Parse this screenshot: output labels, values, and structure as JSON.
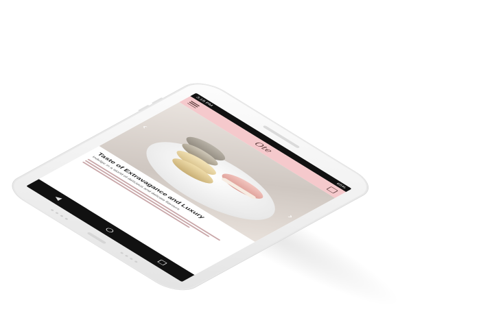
{
  "status_bar": {
    "left": "3:18 PM",
    "right": "65%"
  },
  "app_header": {
    "logo": "Ote"
  },
  "hero": {
    "prev_arrow": "‹",
    "next_arrow": "›"
  },
  "article": {
    "headline": "Taste of Extravagance and Luxury",
    "subhead": "Indulge in a world of delicious and delicate flavours"
  },
  "colors": {
    "header_bg": "#f5c9cc",
    "status_bar_bg": "#111111",
    "nav_bar_bg": "#111111"
  },
  "icons": [
    "menu-icon",
    "cart-icon",
    "back-icon",
    "home-icon",
    "recents-icon"
  ]
}
